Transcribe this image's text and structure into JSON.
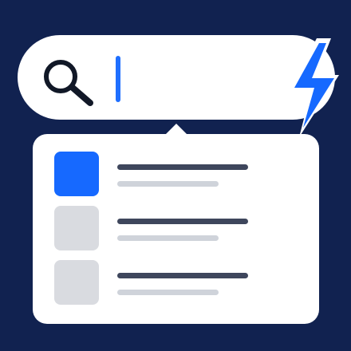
{
  "colors": {
    "background": "#112250",
    "surface": "#ffffff",
    "accent": "#1669ff",
    "text_primary": "#3e465c",
    "text_secondary": "#cfd3da",
    "thumbnail_inactive": "#d9dbe0"
  },
  "search": {
    "value": "",
    "icon": "search-icon",
    "caret": "text-cursor",
    "action_icon": "lightning-bolt-icon"
  },
  "dropdown": {
    "results": [
      {
        "state": "selected",
        "thumbnail": "thumbnail-placeholder",
        "title_line": "placeholder-line",
        "subtitle_line": "placeholder-line"
      },
      {
        "state": "default",
        "thumbnail": "thumbnail-placeholder",
        "title_line": "placeholder-line",
        "subtitle_line": "placeholder-line"
      },
      {
        "state": "default",
        "thumbnail": "thumbnail-placeholder",
        "title_line": "placeholder-line",
        "subtitle_line": "placeholder-line"
      }
    ]
  }
}
